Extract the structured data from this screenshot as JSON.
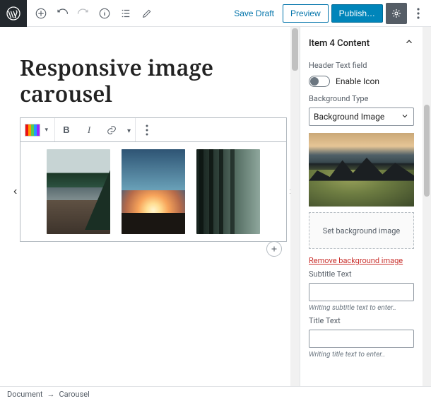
{
  "topbar": {
    "save_draft": "Save Draft",
    "preview": "Preview",
    "publish": "Publish…"
  },
  "editor": {
    "page_title": "Responsive image carousel",
    "toolbar": {
      "bold": "B",
      "italic": "I"
    }
  },
  "sidebar": {
    "panel_title": "Item 4 Content",
    "header_text_field_label": "Header Text field",
    "enable_icon_label": "Enable Icon",
    "background_type_label": "Background Type",
    "background_type_value": "Background Image",
    "set_bg_image": "Set background image",
    "remove_bg_image": "Remove background image",
    "subtitle_label": "Subtitle Text",
    "subtitle_hint": "Writing subtitle text to enter..",
    "title_label": "Title Text",
    "title_hint": "Writing title text to enter.."
  },
  "breadcrumb": {
    "root": "Document",
    "sep": "→",
    "current": "Carousel"
  }
}
